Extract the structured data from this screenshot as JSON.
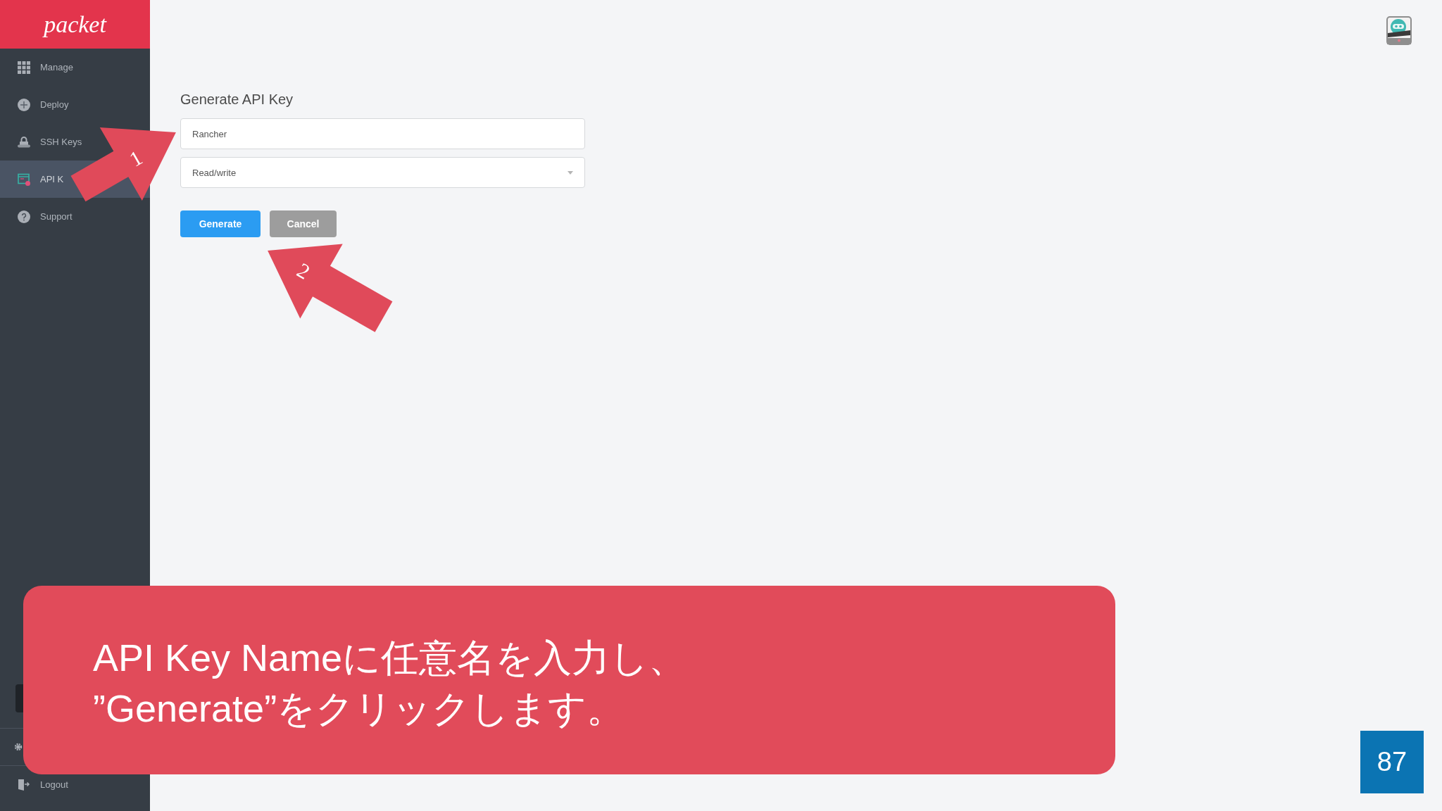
{
  "sidebar": {
    "logo": "packet",
    "items": [
      {
        "label": "Manage",
        "selected": false
      },
      {
        "label": "Deploy",
        "selected": false
      },
      {
        "label": "SSH Keys",
        "selected": false
      },
      {
        "label": "API K",
        "selected": true
      },
      {
        "label": "Support",
        "selected": false
      }
    ],
    "logout_label": "Logout"
  },
  "form": {
    "title": "Generate API Key",
    "name_field": {
      "value": "Rancher"
    },
    "permission_select": {
      "value": "Read/write"
    },
    "buttons": [
      {
        "label": "Generate",
        "kind": "primary"
      },
      {
        "label": "Cancel",
        "kind": "secondary"
      }
    ]
  },
  "callouts": [
    {
      "number": "1"
    },
    {
      "number": "2"
    }
  ],
  "caption": {
    "lines": [
      "API Key Nameに任意名を入力し、",
      "”Generate”をクリックします。"
    ]
  },
  "page_number": "87"
}
